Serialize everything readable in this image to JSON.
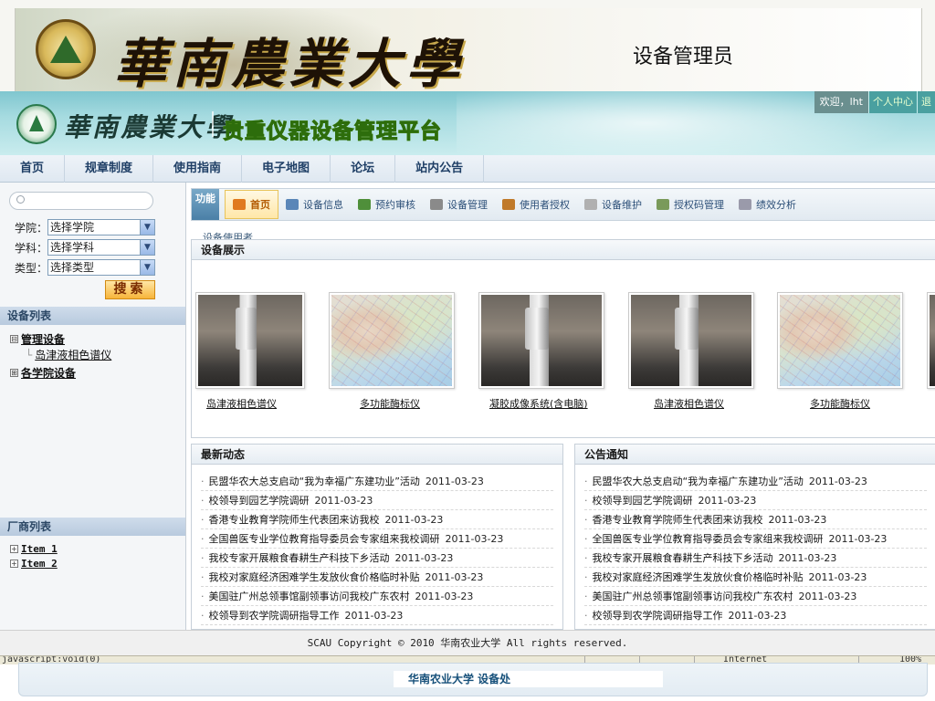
{
  "banner": {
    "school_name": "華南農業大學",
    "role": "设备管理员"
  },
  "platform": {
    "school_name": "華南農業大學",
    "name": "贵重仪器设备管理平台",
    "welcome": "欢迎，lht",
    "user_center": "个人中心",
    "logout": "退"
  },
  "topnav": [
    "首页",
    "规章制度",
    "使用指南",
    "电子地图",
    "论坛",
    "站内公告"
  ],
  "sidebar": {
    "search_placeholder": "",
    "filters": [
      {
        "label": "学院：",
        "value": "选择学院"
      },
      {
        "label": "学科：",
        "value": "选择学科"
      },
      {
        "label": "类型：",
        "value": "选择类型"
      }
    ],
    "search_button": "搜索",
    "device_list_title": "设备列表",
    "device_tree": [
      {
        "toggle": "⊟",
        "label": "管理设备",
        "children": [
          "岛津液相色谱仪"
        ]
      },
      {
        "toggle": "⊞",
        "label": "各学院设备",
        "children": []
      }
    ],
    "vendor_list_title": "厂商列表",
    "vendor_tree": [
      "Item 1",
      "Item 2"
    ]
  },
  "funcbar": {
    "label": "功能",
    "tabs": [
      {
        "label": "首页",
        "icon": "home-icon",
        "color": "#e07a1f"
      },
      {
        "label": "设备信息",
        "icon": "info-icon",
        "color": "#5a86b8"
      },
      {
        "label": "预约审核",
        "icon": "review-icon",
        "color": "#4f8f3a"
      },
      {
        "label": "设备管理",
        "icon": "device-gear-icon",
        "color": "#8a8a8a"
      },
      {
        "label": "使用者授权",
        "icon": "users-icon",
        "color": "#c07a2a"
      },
      {
        "label": "设备维护",
        "icon": "tools-icon",
        "color": "#b0b0b0"
      },
      {
        "label": "授权码管理",
        "icon": "key-icon",
        "color": "#7a9a5a"
      },
      {
        "label": "绩效分析",
        "icon": "chart-icon",
        "color": "#9a9aaa"
      }
    ],
    "sub_hint": "设备使用者"
  },
  "device_show": {
    "title": "设备展示",
    "items": [
      {
        "name": "岛津液相色谱仪",
        "image": "instrument"
      },
      {
        "name": "多功能酶标仪",
        "image": "map"
      },
      {
        "name": "凝胶成像系统(含电脑)",
        "image": "instrument"
      },
      {
        "name": "岛津液相色谱仪",
        "image": "instrument"
      },
      {
        "name": "多功能酶标仪",
        "image": "map"
      },
      {
        "name": "",
        "image": "instrument"
      }
    ]
  },
  "news": {
    "title": "最新动态",
    "items": [
      {
        "text": "民盟华农大总支启动“我为幸福广东建功业”活动",
        "date": "2011-03-23"
      },
      {
        "text": "校领导到园艺学院调研",
        "date": "2011-03-23"
      },
      {
        "text": "香港专业教育学院师生代表团来访我校",
        "date": "2011-03-23"
      },
      {
        "text": "全国兽医专业学位教育指导委员会专家组来我校调研",
        "date": "2011-03-23"
      },
      {
        "text": "我校专家开展粮食春耕生产科技下乡活动",
        "date": "2011-03-23"
      },
      {
        "text": "我校对家庭经济困难学生发放伙食价格临时补贴",
        "date": "2011-03-23"
      },
      {
        "text": "美国驻广州总领事馆副领事访问我校广东农村",
        "date": "2011-03-23"
      },
      {
        "text": "校领导到农学院调研指导工作",
        "date": "2011-03-23"
      }
    ]
  },
  "notices": {
    "title": "公告通知",
    "items": [
      {
        "text": "民盟华农大总支启动“我为幸福广东建功业”活动",
        "date": "2011-03-23"
      },
      {
        "text": "校领导到园艺学院调研",
        "date": "2011-03-23"
      },
      {
        "text": "香港专业教育学院师生代表团来访我校",
        "date": "2011-03-23"
      },
      {
        "text": "全国兽医专业学位教育指导委员会专家组来我校调研",
        "date": "2011-03-23"
      },
      {
        "text": "我校专家开展粮食春耕生产科技下乡活动",
        "date": "2011-03-23"
      },
      {
        "text": "我校对家庭经济困难学生发放伙食价格临时补贴",
        "date": "2011-03-23"
      },
      {
        "text": "美国驻广州总领事馆副领事访问我校广东农村",
        "date": "2011-03-23"
      },
      {
        "text": "校领导到农学院调研指导工作",
        "date": "2011-03-23"
      }
    ]
  },
  "footer": {
    "copyright": "SCAU Copyright © 2010 华南农业大学 All rights reserved.",
    "statusbar_left": "javascript:void(0)",
    "statusbar_zone": "Internet",
    "statusbar_zoom": "100%",
    "outer_text": "华南农业大学    设备处"
  }
}
